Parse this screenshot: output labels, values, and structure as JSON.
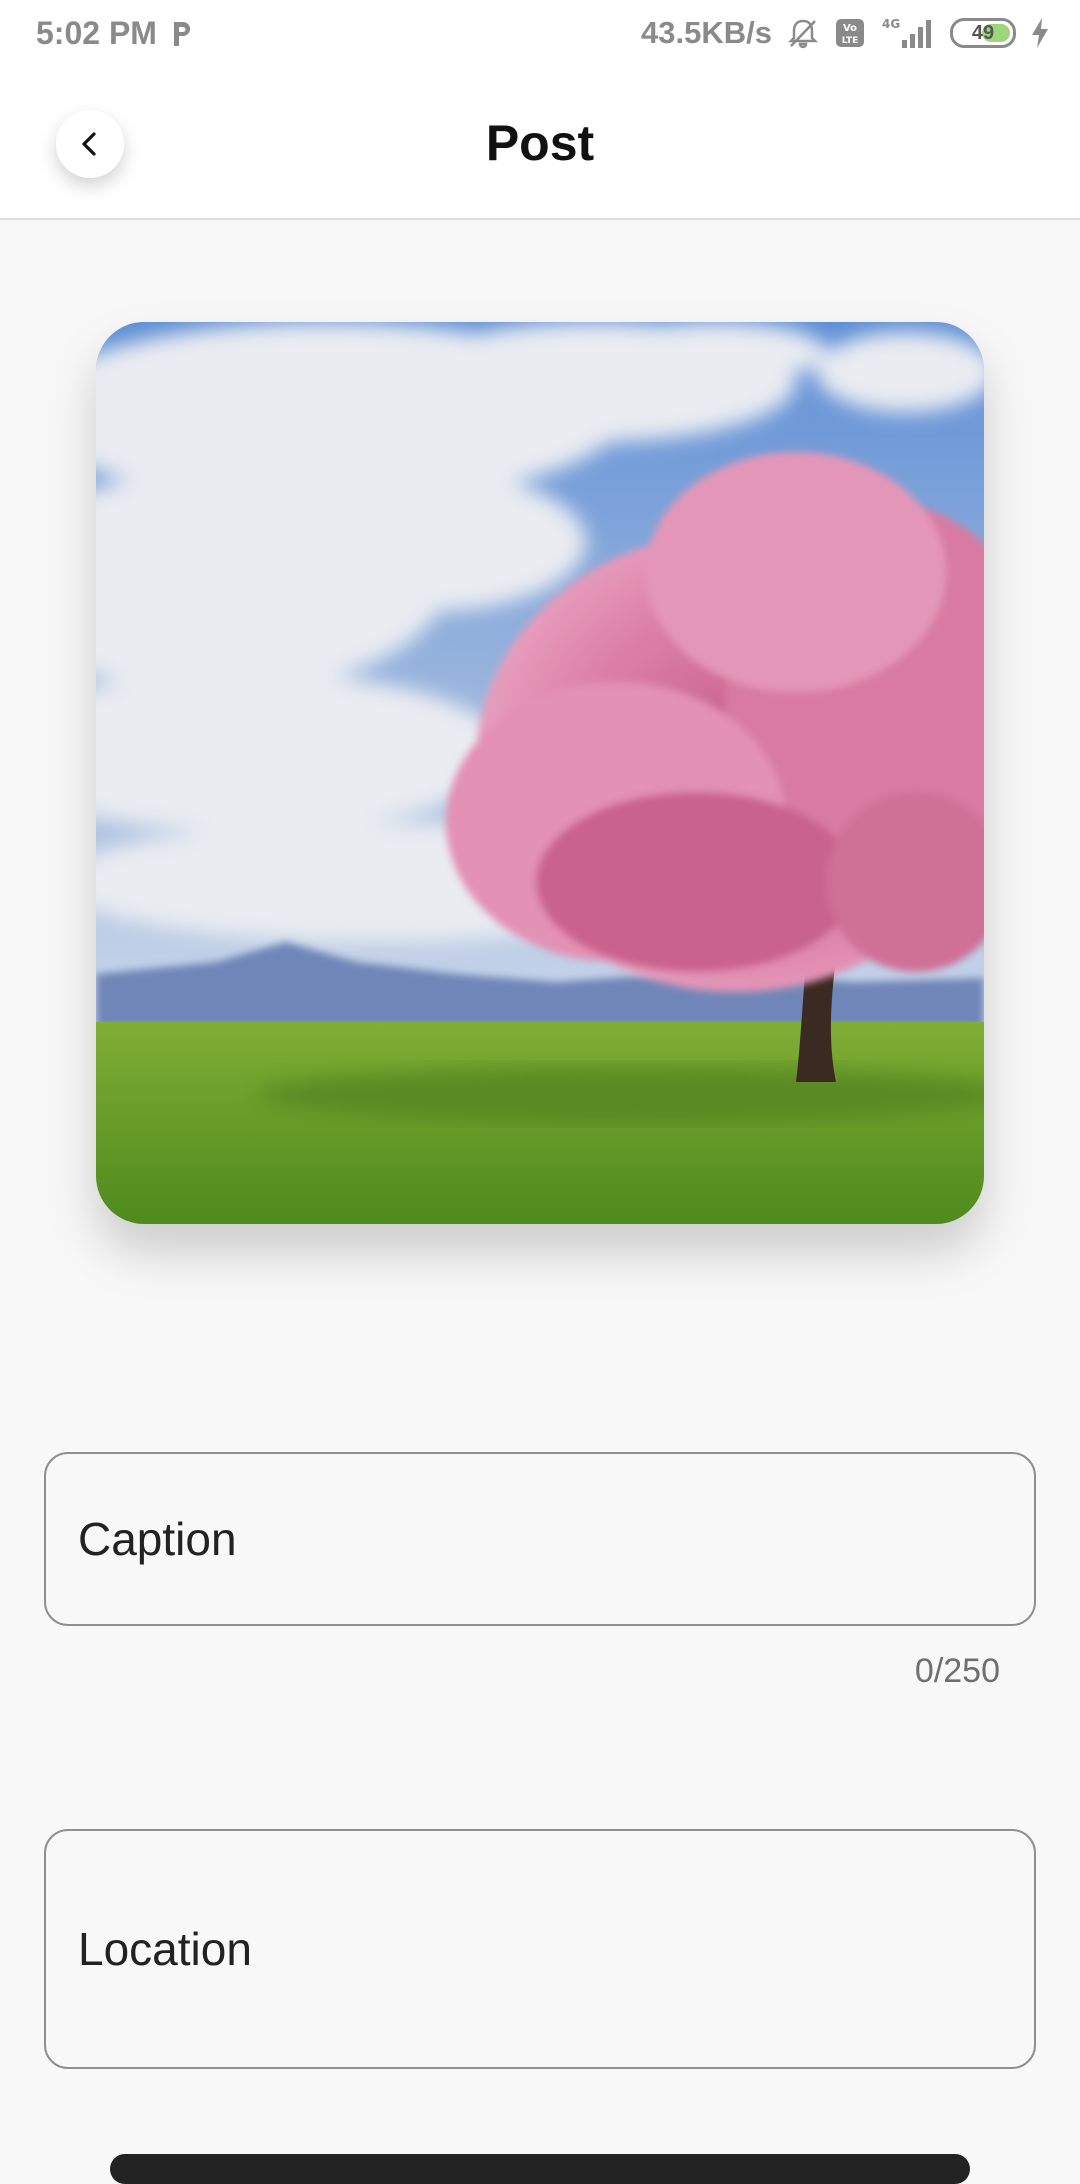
{
  "status_bar": {
    "time": "5:02 PM",
    "net_speed": "43.5KB/s",
    "battery": "49",
    "icons": [
      "p-app-icon",
      "mute-bell-icon",
      "volte-icon",
      "4g-signal-icon",
      "battery-icon",
      "charging-icon"
    ]
  },
  "header": {
    "title": "Post",
    "back_icon": "chevron-left-icon"
  },
  "post_image": {
    "subject": "pink-blossom-tree-photo"
  },
  "caption": {
    "placeholder": "Caption",
    "counter": "0/250"
  },
  "location": {
    "placeholder": "Location"
  },
  "colors": {
    "background": "#f8f8f8",
    "appbar": "#ffffff",
    "border": "#8f8f8f",
    "text": "#111111"
  }
}
